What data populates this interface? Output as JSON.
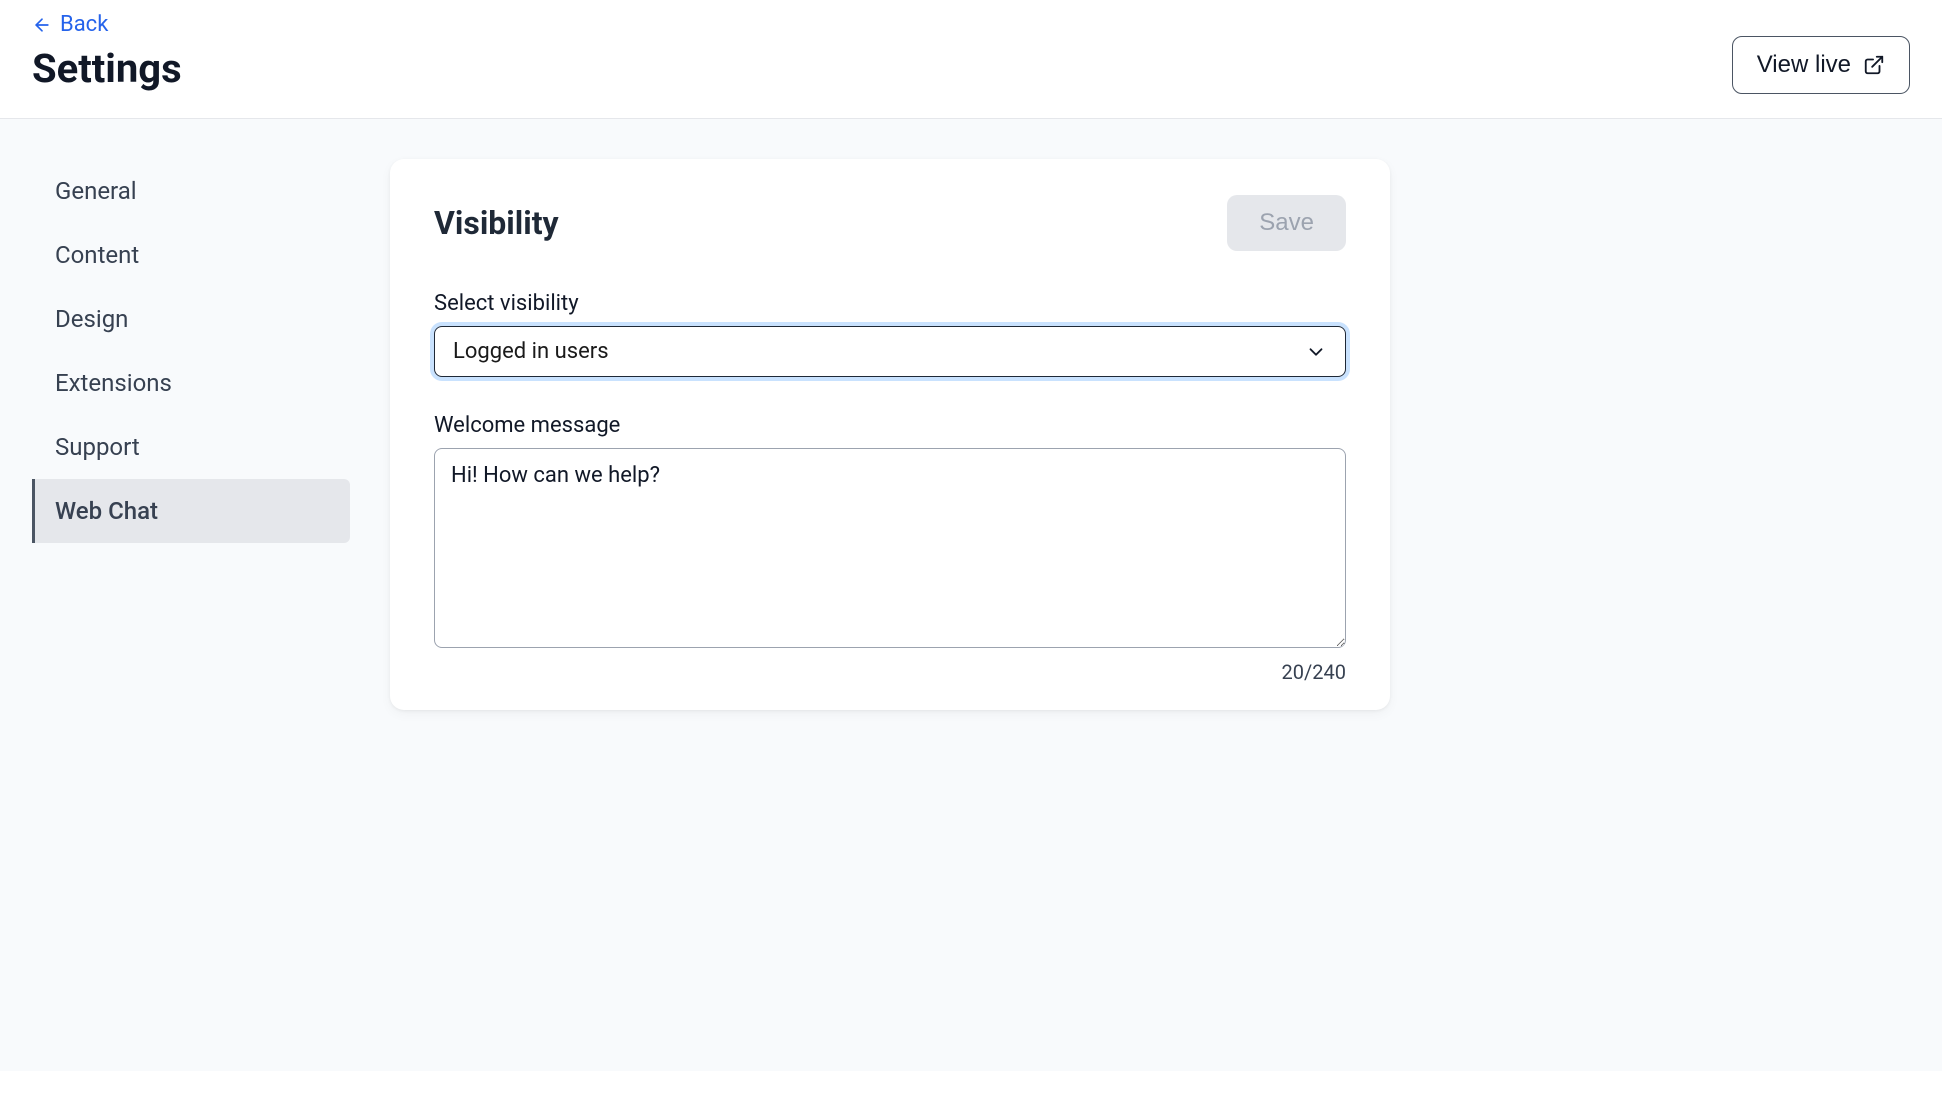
{
  "header": {
    "back_label": "Back",
    "page_title": "Settings",
    "view_live_label": "View live"
  },
  "sidebar": {
    "items": [
      {
        "label": "General",
        "active": false
      },
      {
        "label": "Content",
        "active": false
      },
      {
        "label": "Design",
        "active": false
      },
      {
        "label": "Extensions",
        "active": false
      },
      {
        "label": "Support",
        "active": false
      },
      {
        "label": "Web Chat",
        "active": true
      }
    ]
  },
  "card": {
    "title": "Visibility",
    "save_label": "Save",
    "visibility_label": "Select visibility",
    "visibility_value": "Logged in users",
    "welcome_label": "Welcome message",
    "welcome_value": "Hi! How can we help?",
    "char_counter": "20/240"
  }
}
